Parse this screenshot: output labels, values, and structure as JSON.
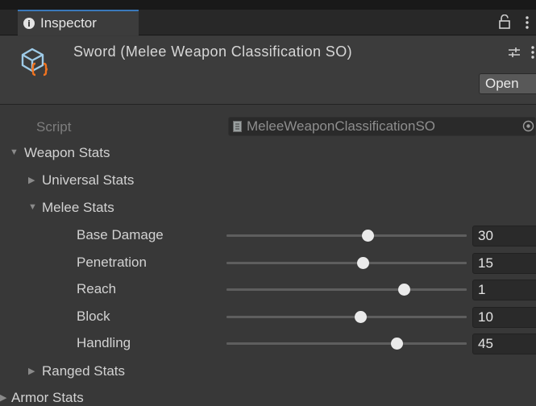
{
  "window": {
    "tab_label": "Inspector",
    "header_title": "Sword (Melee Weapon Classification SO)",
    "open_button_label": "Open"
  },
  "icons": {
    "tab": "info-icon",
    "lock": "lock-icon",
    "menu": "kebab-menu-icon",
    "asset": "scriptable-object-icon",
    "settings": "settings-icon",
    "script_file": "script-file-icon",
    "picker": "object-picker-icon"
  },
  "script": {
    "label": "Script",
    "value": "MeleeWeaponClassificationSO"
  },
  "tree": {
    "weapon_stats": "Weapon Stats",
    "universal_stats": "Universal Stats",
    "melee_stats": "Melee Stats",
    "ranged_stats": "Ranged Stats",
    "armor_stats": "Armor Stats"
  },
  "melee": [
    {
      "label": "Base Damage",
      "value": "30",
      "fraction": 0.59
    },
    {
      "label": "Penetration",
      "value": "15",
      "fraction": 0.57
    },
    {
      "label": "Reach",
      "value": "1",
      "fraction": 0.74
    },
    {
      "label": "Block",
      "value": "10",
      "fraction": 0.56
    },
    {
      "label": "Handling",
      "value": "45",
      "fraction": 0.71
    }
  ],
  "colors": {
    "background": "#383838",
    "tab_accent": "#3a79bb",
    "asset_icon_orange": "#f0731f",
    "asset_icon_blue": "#9ecbe8"
  }
}
